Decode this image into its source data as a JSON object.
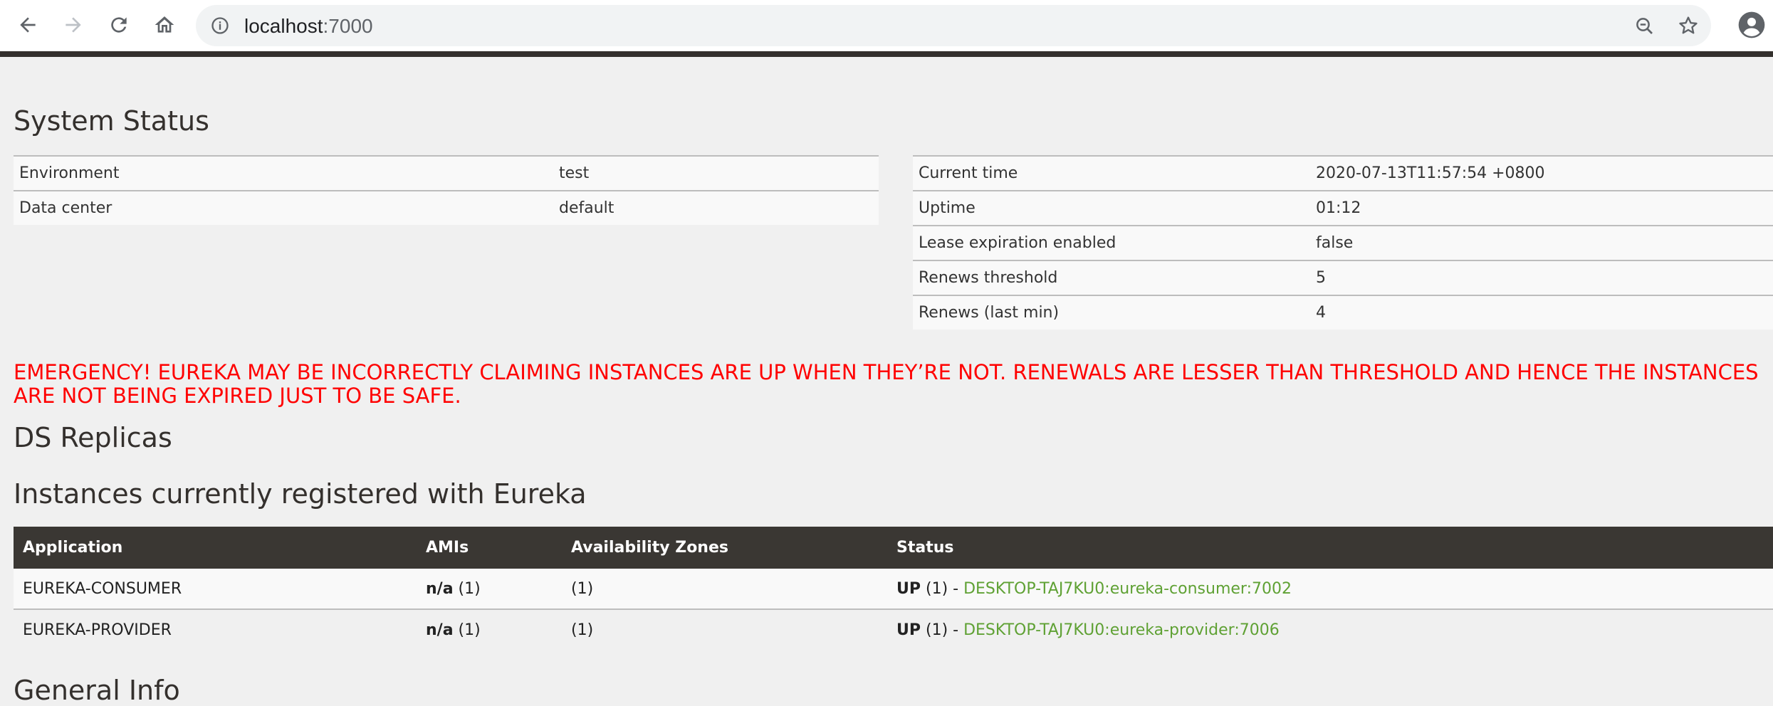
{
  "browser": {
    "url_host": "localhost",
    "url_port": ":7000",
    "icons": [
      "back-arrow-icon",
      "forward-arrow-icon",
      "reload-icon",
      "home-icon",
      "info-icon",
      "zoom-out-icon",
      "star-icon",
      "account-icon"
    ]
  },
  "system_status": {
    "title": "System Status",
    "left": [
      {
        "key": "Environment",
        "value": "test"
      },
      {
        "key": "Data center",
        "value": "default"
      }
    ],
    "right": [
      {
        "key": "Current time",
        "value": "2020-07-13T11:57:54 +0800"
      },
      {
        "key": "Uptime",
        "value": "01:12"
      },
      {
        "key": "Lease expiration enabled",
        "value": "false"
      },
      {
        "key": "Renews threshold",
        "value": "5"
      },
      {
        "key": "Renews (last min)",
        "value": "4"
      }
    ]
  },
  "emergency": {
    "line1": "EMERGENCY! EUREKA MAY BE INCORRECTLY CLAIMING INSTANCES ARE UP WHEN THEY’RE NOT. RENEWALS ARE LESSER THAN THRESHOLD AND HENCE THE INSTANCES",
    "line2": "ARE NOT BEING EXPIRED JUST TO BE SAFE.",
    "color": "#ff0000"
  },
  "ds_replicas": {
    "title": "DS Replicas"
  },
  "instances": {
    "title": "Instances currently registered with Eureka",
    "headers": [
      "Application",
      "AMIs",
      "Availability Zones",
      "Status"
    ],
    "rows": [
      {
        "application": "EUREKA-CONSUMER",
        "ami_label": "n/a",
        "ami_count": " (1)",
        "az": "(1)",
        "status_label": "UP",
        "status_count": " (1) - ",
        "instance": "DESKTOP-TAJ7KU0:eureka-consumer:7002"
      },
      {
        "application": "EUREKA-PROVIDER",
        "ami_label": "n/a",
        "ami_count": " (1)",
        "az": "(1)",
        "status_label": "UP",
        "status_count": " (1) - ",
        "instance": "DESKTOP-TAJ7KU0:eureka-provider:7006"
      }
    ],
    "link_color": "#5fa134"
  },
  "general_info": {
    "title": "General Info"
  },
  "colors": {
    "header_bar": "#34302d",
    "background": "#f0f0f0"
  }
}
